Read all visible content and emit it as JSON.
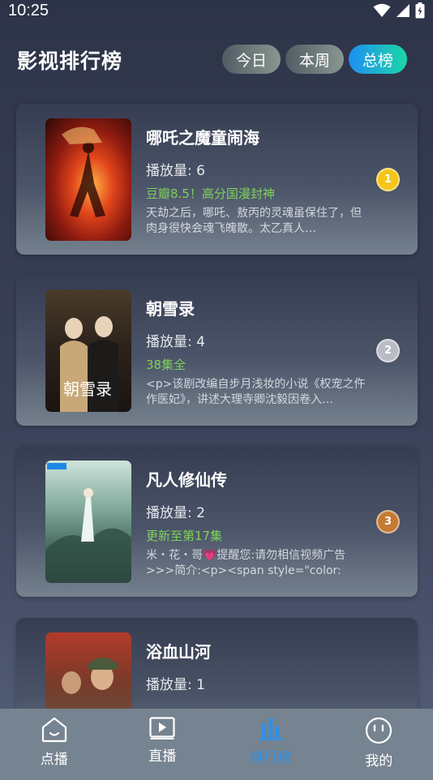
{
  "status": {
    "time": "10:25"
  },
  "header": {
    "title": "影视排行榜"
  },
  "tabs": [
    {
      "label": "今日",
      "active": false
    },
    {
      "label": "本周",
      "active": false
    },
    {
      "label": "总榜",
      "active": true
    }
  ],
  "items": [
    {
      "title": "哪吒之魔童闹海",
      "plays": "播放量: 6",
      "tag": "豆瓣8.5！高分国漫封神",
      "desc": "天劫之后，哪吒、敖丙的灵魂虽保住了，但肉身很快会魂飞魄散。太乙真人…",
      "rank": "1",
      "rank_color": "#f5c518"
    },
    {
      "title": "朝雪录",
      "plays": "播放量: 4",
      "tag": "38集全",
      "desc": "<p>该剧改编自步月浅妆的小说《权宠之仵作医妃》，讲述大理寺卿沈毅因卷入…",
      "rank": "2",
      "rank_color": "#b8bcc4"
    },
    {
      "title": "凡人修仙传",
      "plays": "播放量: 2",
      "tag": "更新至第17集",
      "desc": "米・花・哥💗提醒您:请勿相信视频广告>>>简介:<p><span style=\"color: rg…",
      "rank": "3",
      "rank_color": "#c57a33"
    },
    {
      "title": "浴血山河",
      "plays": "播放量: 1",
      "tag": "",
      "desc": "",
      "rank": "",
      "rank_color": "#888888"
    }
  ],
  "nav": [
    {
      "label": "点播",
      "icon": "home-icon",
      "active": false
    },
    {
      "label": "直播",
      "icon": "play-icon",
      "active": false
    },
    {
      "label": "排行榜",
      "icon": "chart-icon",
      "active": true
    },
    {
      "label": "我的",
      "icon": "smile-icon",
      "active": false
    }
  ]
}
